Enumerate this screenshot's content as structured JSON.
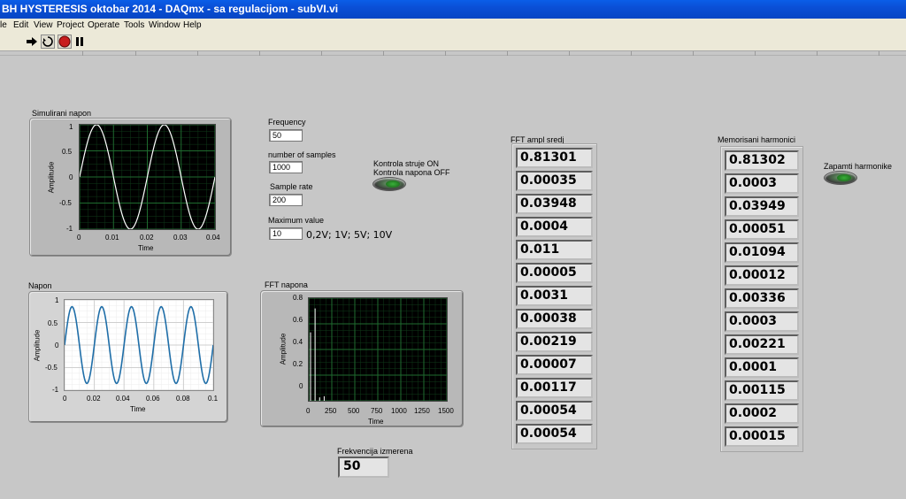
{
  "window": {
    "title": "BH HYSTERESIS oktobar 2014 - DAQmx - sa regulacijom - subVI.vi"
  },
  "menu": [
    "le",
    "Edit",
    "View",
    "Project",
    "Operate",
    "Tools",
    "Window",
    "Help"
  ],
  "toolbar": [
    "run-arrow-icon",
    "run-continuous-icon",
    "abort-icon",
    "pause-icon"
  ],
  "graph_simulirani": {
    "label": "Simulirani napon",
    "xlabel": "Time",
    "ylabel": "Amplitude",
    "xticks": [
      "0",
      "0.01",
      "0.02",
      "0.03",
      "0.04"
    ],
    "yticks": [
      "1",
      "0.5",
      "0",
      "-0.5",
      "-1"
    ]
  },
  "graph_napon": {
    "label": "Napon",
    "xlabel": "Time",
    "ylabel": "Amplitude",
    "xticks": [
      "0",
      "0.02",
      "0.04",
      "0.06",
      "0.08",
      "0.1"
    ],
    "yticks": [
      "1",
      "0.5",
      "0",
      "-0.5",
      "-1"
    ]
  },
  "graph_fft": {
    "label": "FFT napona",
    "xlabel": "Time",
    "ylabel": "Amplitude",
    "xticks": [
      "0",
      "250",
      "500",
      "750",
      "1000",
      "1250",
      "1500"
    ],
    "yticks": [
      "0.8",
      "0.6",
      "0.4",
      "0.2",
      "0"
    ]
  },
  "controls": {
    "frequency_label": "Frequency",
    "frequency_value": "50",
    "samples_label": "number of samples",
    "samples_value": "1000",
    "rate_label": "Sample rate",
    "rate_value": "200",
    "max_label": "Maximum value",
    "max_value": "10",
    "max_note": "0,2V; 1V; 5V; 10V"
  },
  "kontrola": {
    "line1": "Kontrola struje ON",
    "line2": "Kontrola napona OFF"
  },
  "zapamti": {
    "label": "Zapamti harmonike"
  },
  "fft_array": {
    "label": "FFT  ampl sredj",
    "values": [
      "0.81301",
      "0.00035",
      "0.03948",
      "0.0004",
      "0.011",
      "0.00005",
      "0.0031",
      "0.00038",
      "0.00219",
      "0.00007",
      "0.00117",
      "0.00054",
      "0.00054"
    ]
  },
  "mem_array": {
    "label": "Memorisani harmonici",
    "values": [
      "0.81302",
      "0.0003",
      "0.03949",
      "0.00051",
      "0.01094",
      "0.00012",
      "0.00336",
      "0.0003",
      "0.00221",
      "0.0001",
      "0.00115",
      "0.0002",
      "0.00015"
    ]
  },
  "frekvencija": {
    "label": "Frekvencija izmerena",
    "value": "50"
  },
  "chart_data": [
    {
      "type": "line",
      "name": "Simulirani napon",
      "xlabel": "Time",
      "ylabel": "Amplitude",
      "xlim": [
        0,
        0.04
      ],
      "ylim": [
        -1,
        1
      ],
      "frequency": 50,
      "amplitude": 1,
      "grid": true
    },
    {
      "type": "line",
      "name": "Napon",
      "xlabel": "Time",
      "ylabel": "Amplitude",
      "xlim": [
        0,
        0.1
      ],
      "ylim": [
        -1,
        1
      ],
      "frequency": 50,
      "amplitude": 0.85,
      "grid": true
    },
    {
      "type": "bar",
      "name": "FFT napona",
      "xlabel": "Time",
      "ylabel": "Amplitude",
      "xlim": [
        0,
        1500
      ],
      "ylim": [
        0,
        0.9
      ],
      "x": [
        0,
        50,
        100,
        150
      ],
      "values": [
        0.6,
        0.81,
        0.03,
        0.04
      ],
      "grid": true
    }
  ]
}
